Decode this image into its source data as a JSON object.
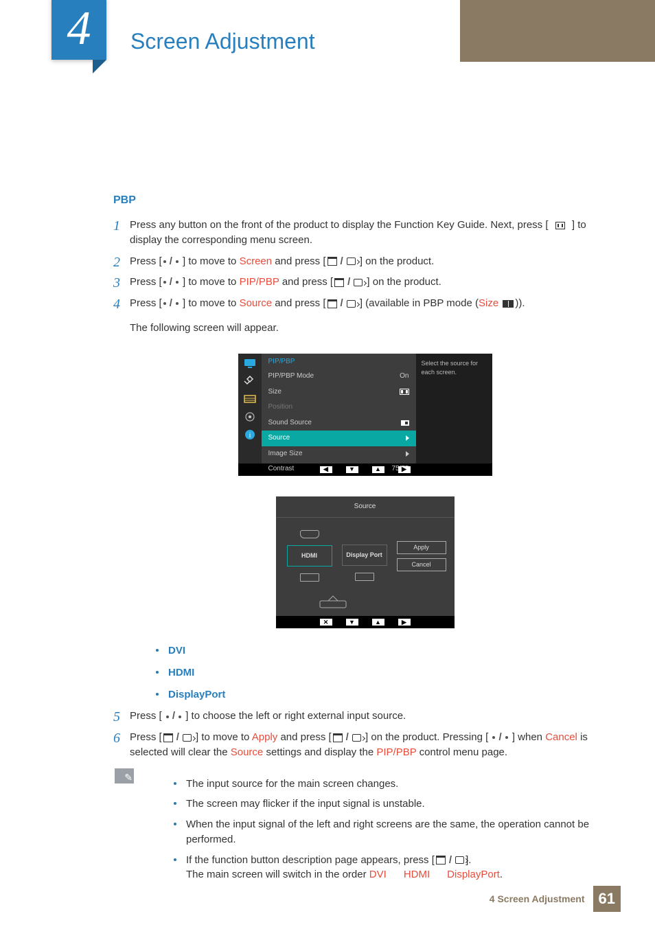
{
  "chapter_number": "4",
  "chapter_title": "Screen Adjustment",
  "section": "PBP",
  "steps": {
    "s1a": "Press any button on the front of the product to display the Function Key Guide. Next, press [",
    "s1b": "] to display the corresponding menu screen.",
    "s2a": "Press [",
    "move_to": "] to move to ",
    "press": " and press [",
    "on_prod": "] on the product.",
    "screen_word": "Screen",
    "pip_word": "PIP/PBP",
    "source_word": "Source",
    "size_word": "Size",
    "s4_tail": "] (available in PBP mode (",
    "s4_close": ")).",
    "following": "The following screen will appear.",
    "s5": "] to choose the left or right external input source.",
    "s6a": "Press [",
    "apply": "Apply",
    "cancel": "Cancel",
    "s6mid": "] on the product. Pressing  [",
    "s6tail": "] when ",
    "s6tail2": " is selected will clear the ",
    "s6tail3": " settings and display the ",
    "s6tail4": " control menu page."
  },
  "options": [
    "DVI",
    "HDMI",
    "DisplayPort"
  ],
  "notes": {
    "n1": "The input source for the main screen changes.",
    "n2": "The screen may flicker if the input signal is unstable.",
    "n3": "When the input signal of the left and right screens are the same, the operation cannot be performed.",
    "n4a": "If the function button description page appears, press  [",
    "n4b": "].",
    "n4c": "The main screen will switch in the order ",
    "seq": [
      "DVI",
      "HDMI",
      "DisplayPort"
    ],
    "period": "."
  },
  "osd": {
    "title": "PIP/PBP",
    "hint": "Select the source for each screen.",
    "rows": [
      {
        "label": "PIP/PBP Mode",
        "val": "On"
      },
      {
        "label": "Size",
        "val": "⬛⬛"
      },
      {
        "label": "Position",
        "val": ""
      },
      {
        "label": "Sound Source",
        "val": "▣"
      },
      {
        "label": "Source",
        "val": "▶"
      },
      {
        "label": "Image Size",
        "val": "▶"
      },
      {
        "label": "Contrast",
        "val": "75/75"
      }
    ],
    "nav1": [
      "◀",
      "▼",
      "▲",
      "▶"
    ]
  },
  "src": {
    "title": "Source",
    "left": "HDMI",
    "right": "Display Port",
    "apply": "Apply",
    "cancel": "Cancel",
    "nav": [
      "✕",
      "▼",
      "▲",
      "▶"
    ]
  },
  "footer": {
    "label": "4 Screen Adjustment",
    "page": "61"
  }
}
